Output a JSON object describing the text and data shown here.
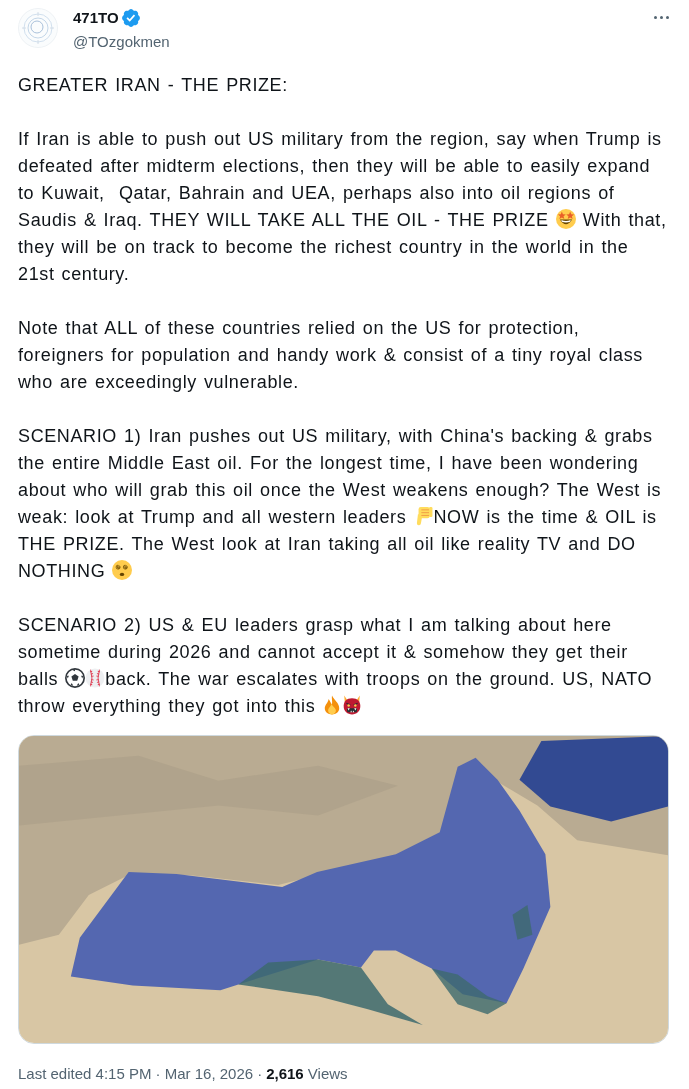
{
  "tweet": {
    "author": {
      "name": "471TO",
      "verified": true,
      "handle": "@TOzgokmen"
    },
    "body": [
      {
        "parts": [
          {
            "kind": "text",
            "text": "GREATER IRAN - THE PRIZE:"
          }
        ]
      },
      {
        "parts": [
          {
            "kind": "text",
            "text": "If Iran is able to push out US military from the region, say when Trump is defeated after midterm elections, then they will be able to easily expand to Kuwait,  Qatar, Bahrain and UEA, perhaps also into oil regions of Saudis & Iraq. THEY WILL TAKE ALL THE OIL - THE PRIZE "
          },
          {
            "kind": "starstruck"
          },
          {
            "kind": "text",
            "text": " With that, they will be on track to become the richest country in the world in the 21st century."
          }
        ]
      },
      {
        "parts": [
          {
            "kind": "text",
            "text": "Note that ALL of these countries relied on the US for protection, foreigners for population and handy work & consist of a tiny royal class who are exceedingly vulnerable."
          }
        ]
      },
      {
        "parts": [
          {
            "kind": "text",
            "text": "SCENARIO 1) Iran pushes out US military, with China's backing & grabs the entire Middle East oil. For the longest time, I have been wondering about who will grab this oil once the West weakens enough? The West is weak: look at Trump and all western leaders "
          },
          {
            "kind": "thumbsdown"
          },
          {
            "kind": "text",
            "text": "NOW is the time & OIL is THE PRIZE. The West look at Iran taking all oil like reality TV and DO NOTHING "
          },
          {
            "kind": "dizzy"
          }
        ]
      },
      {
        "parts": [
          {
            "kind": "text",
            "text": "SCENARIO 2) US & EU leaders grasp what I am talking about here sometime during 2026 and cannot accept it & somehow they get their balls "
          },
          {
            "kind": "soccer"
          },
          {
            "kind": "baseball"
          },
          {
            "kind": "text",
            "text": "back. The war escalates with troops on the ground. US, NATO throw everything they got into this "
          },
          {
            "kind": "fire"
          },
          {
            "kind": "ogre"
          }
        ]
      }
    ],
    "media": [
      {
        "kind": "map"
      }
    ],
    "footer": {
      "timestamp": "Last edited 4:15 PM · Mar 16, 2026",
      "separator": "·",
      "views": "**2,616** Views"
    }
  }
}
